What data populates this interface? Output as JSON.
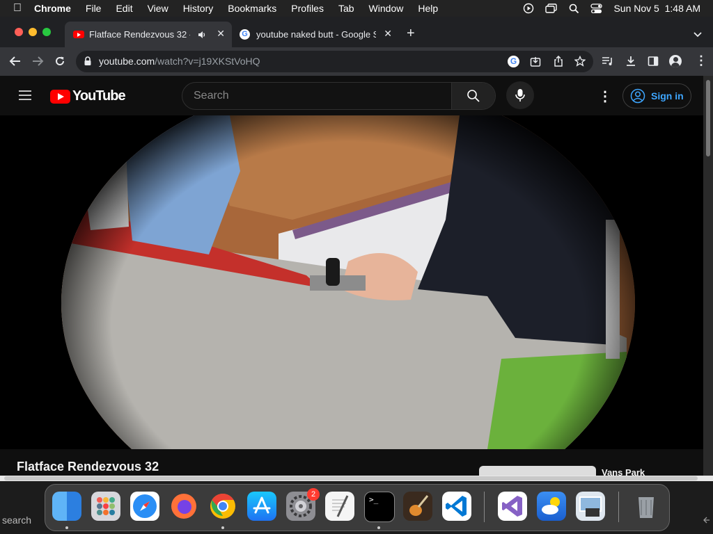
{
  "menubar": {
    "app": "Chrome",
    "items": [
      "File",
      "Edit",
      "View",
      "History",
      "Bookmarks",
      "Profiles",
      "Tab",
      "Window",
      "Help"
    ],
    "clock": "Sun Nov 5  1:48 AM"
  },
  "tabs": [
    {
      "title": "Flatface Rendezvous 32 -",
      "active": true
    },
    {
      "title": "youtube naked butt - Google S",
      "active": false
    }
  ],
  "toolbar": {
    "url_host": "youtube.com",
    "url_path": "/watch?v=j19XKStVoHQ"
  },
  "youtube": {
    "logo_text": "YouTube",
    "search_placeholder": "Search",
    "sign_in": "Sign in",
    "video_title": "Flatface Rendezvous 32",
    "side_video_title": "Vans Park"
  },
  "dock": {
    "apps": [
      "Finder",
      "Launchpad",
      "Safari",
      "Firefox",
      "Chrome",
      "App Store",
      "System Settings",
      "TextEdit",
      "Terminal",
      "GarageBand",
      "Visual Studio Code",
      "Visual Studio",
      "Weather",
      "Preview",
      "Trash"
    ],
    "settings_badge": "2",
    "search_label": "search"
  },
  "colors": {
    "youtube_red": "#ff0000",
    "signin_blue": "#3ea6ff",
    "menubar_bg": "#232323",
    "tabstrip_bg": "#202124",
    "toolbar_bg": "#35363a"
  }
}
